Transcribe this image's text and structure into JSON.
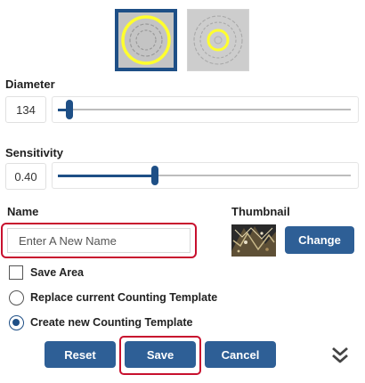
{
  "presets": [
    {
      "name": "large-ring-template",
      "selected": true
    },
    {
      "name": "small-ring-template",
      "selected": false
    }
  ],
  "diameter": {
    "label": "Diameter",
    "value": "134",
    "fraction": 0.04
  },
  "sensitivity": {
    "label": "Sensitivity",
    "value": "0.40",
    "fraction": 0.33
  },
  "name_section": {
    "label": "Name",
    "placeholder": "Enter A New Name",
    "value": ""
  },
  "thumbnail_section": {
    "label": "Thumbnail",
    "change_label": "Change"
  },
  "options": {
    "save_area": {
      "label": "Save Area",
      "checked": false
    },
    "replace_template": {
      "label": "Replace current Counting Template",
      "checked": false
    },
    "create_template": {
      "label": "Create new Counting Template",
      "checked": true
    }
  },
  "actions": {
    "reset": "Reset",
    "save": "Save",
    "cancel": "Cancel"
  },
  "icons": {
    "expand": "double-chevron-down-icon"
  },
  "colors": {
    "accent": "#1e4f86",
    "button": "#2e5f96",
    "highlight": "#c8102e",
    "ring": "#ffff2e"
  }
}
